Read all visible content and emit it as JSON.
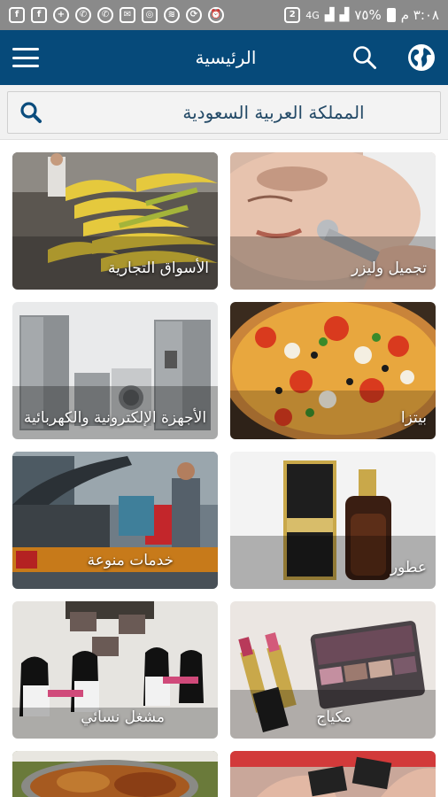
{
  "status": {
    "time": "٣:٠٨ م",
    "battery": "%٧٥",
    "network": "4G",
    "sim": "2"
  },
  "appbar": {
    "title": "الرئيسية"
  },
  "search": {
    "location": "المملكة العربية السعودية"
  },
  "categories": [
    {
      "label": "تجميل وليزر"
    },
    {
      "label": "الأسواق التجارية"
    },
    {
      "label": "بيتزا"
    },
    {
      "label": "الأجهزة الإلكترونية والكهربائية"
    },
    {
      "label": "عطور"
    },
    {
      "label": "خدمات منوعة"
    },
    {
      "label": "مكياج"
    },
    {
      "label": "مشغل نسائي"
    },
    {
      "label": ""
    },
    {
      "label": ""
    }
  ],
  "colors": {
    "appbar": "#064a7a",
    "statusbar": "#8a8a8a"
  }
}
